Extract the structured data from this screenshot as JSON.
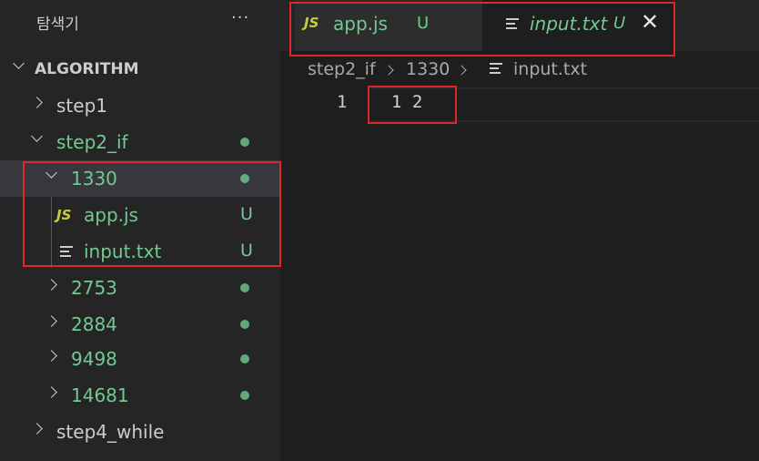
{
  "explorer": {
    "title": "탐색기",
    "more": "···",
    "root": "ALGORITHM"
  },
  "tree": {
    "step1": "step1",
    "step2_if": "step2_if",
    "f1330": "1330",
    "appjs": "app.js",
    "inputtxt": "input.txt",
    "f2753": "2753",
    "f2884": "2884",
    "f9498": "9498",
    "f14681": "14681",
    "step4_while": "step4_while",
    "untracked_badge": "U",
    "js_badge": "JS"
  },
  "tabs": [
    {
      "label": "app.js",
      "status": "U",
      "icon": "JS"
    },
    {
      "label": "input.txt",
      "status": "U",
      "close": "✕"
    }
  ],
  "breadcrumb": [
    "step2_if",
    "1330",
    "input.txt"
  ],
  "editor": {
    "line_number": "1",
    "line_text": "1 2"
  },
  "colors": {
    "modified_green": "#73c991",
    "js_yellow": "#cbcb41",
    "highlight_red": "#e0262b"
  }
}
